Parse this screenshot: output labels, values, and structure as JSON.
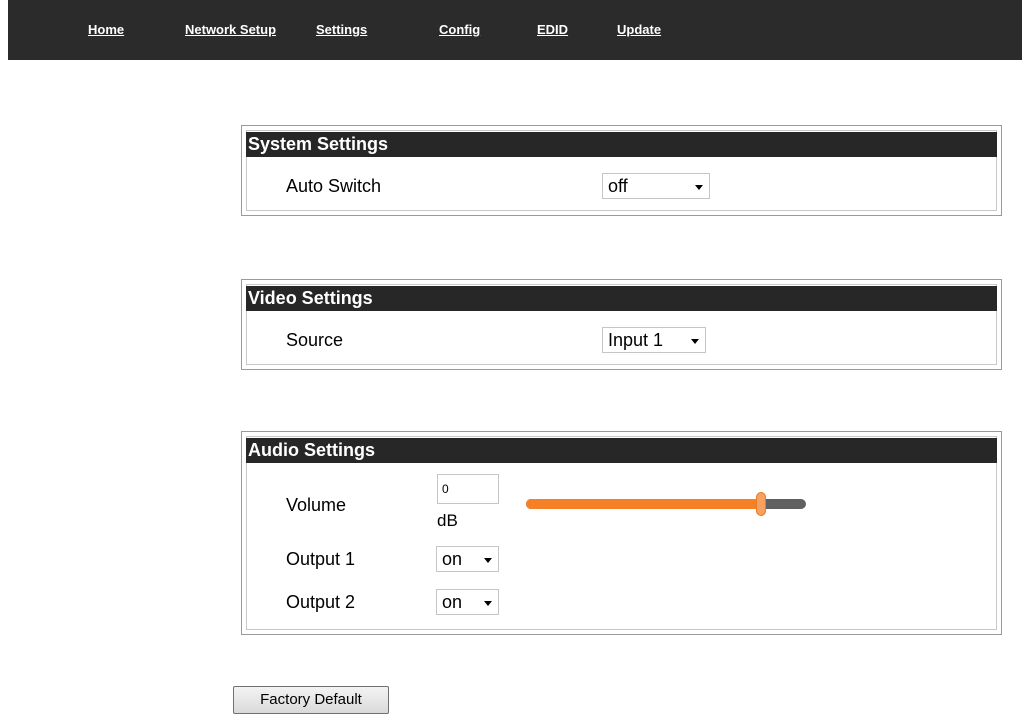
{
  "nav": {
    "home": "Home",
    "network_setup": "Network Setup",
    "settings": "Settings",
    "config": "Config",
    "edid": "EDID",
    "update": "Update"
  },
  "system_settings": {
    "title": "System Settings",
    "auto_switch_label": "Auto Switch",
    "auto_switch_value": "off"
  },
  "video_settings": {
    "title": "Video Settings",
    "source_label": "Source",
    "source_value": "Input 1"
  },
  "audio_settings": {
    "title": "Audio Settings",
    "volume_label": "Volume",
    "volume_value": "0",
    "volume_unit": "dB",
    "volume_slider_fraction": 0.84,
    "output1_label": "Output 1",
    "output1_value": "on",
    "output2_label": "Output 2",
    "output2_value": "on"
  },
  "factory_default_label": "Factory Default",
  "colors": {
    "navbar": "#2b2b2b",
    "header": "#272727",
    "slider_fill": "#f58025",
    "slider_track": "#606060"
  }
}
